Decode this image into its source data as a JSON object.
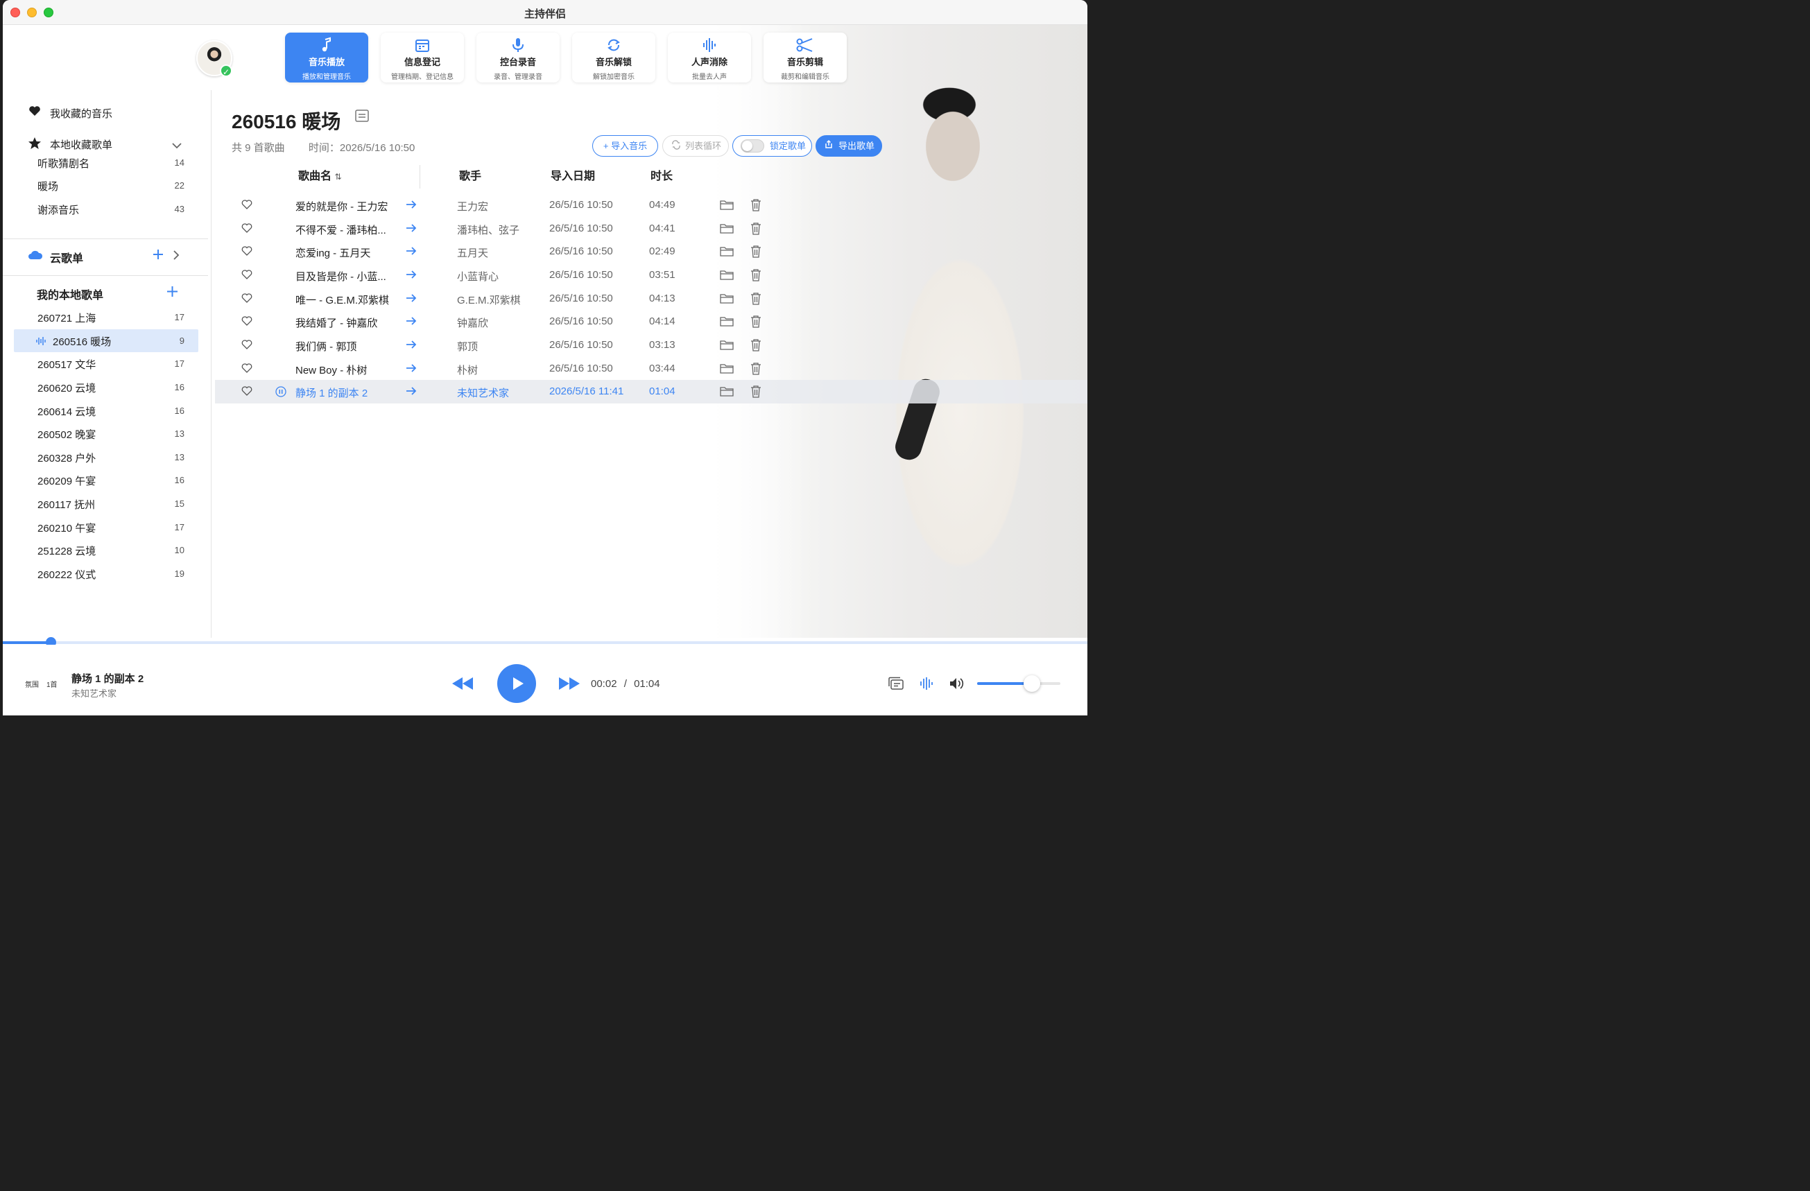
{
  "window": {
    "title": "主持伴侣"
  },
  "colors": {
    "accent": "#3d85f2",
    "selected_bg": "#dde9fb",
    "playing_row_bg": "#e8eaee"
  },
  "toolbar": {
    "tools": [
      {
        "label": "音乐播放",
        "sub": "播放和管理音乐",
        "icon": "music-note-icon",
        "active": true
      },
      {
        "label": "信息登记",
        "sub": "管理档期、登记信息",
        "icon": "calendar-icon",
        "active": false
      },
      {
        "label": "控台录音",
        "sub": "录音、管理录音",
        "icon": "microphone-icon",
        "active": false
      },
      {
        "label": "音乐解锁",
        "sub": "解锁加密音乐",
        "icon": "refresh-unlock-icon",
        "active": false
      },
      {
        "label": "人声消除",
        "sub": "批量去人声",
        "icon": "waveform-icon",
        "active": false
      },
      {
        "label": "音乐剪辑",
        "sub": "裁剪和编辑音乐",
        "icon": "scissors-icon",
        "active": false
      }
    ]
  },
  "sidebar": {
    "favorites": "我收藏的音乐",
    "local_collected": {
      "title": "本地收藏歌单",
      "items": [
        {
          "name": "听歌猜剧名",
          "count": "14"
        },
        {
          "name": "暖场",
          "count": "22"
        },
        {
          "name": "谢添音乐",
          "count": "43"
        }
      ]
    },
    "cloud": {
      "title": "云歌单"
    },
    "my_local": {
      "title": "我的本地歌单",
      "items": [
        {
          "name": "260721 上海",
          "count": "17"
        },
        {
          "name": "260516 暖场",
          "count": "9",
          "selected": true
        },
        {
          "name": "260517 文华",
          "count": "17"
        },
        {
          "name": "260620 云境",
          "count": "16"
        },
        {
          "name": "260614 云境",
          "count": "16"
        },
        {
          "name": "260502 晚宴",
          "count": "13"
        },
        {
          "name": "260328 户外",
          "count": "13"
        },
        {
          "name": "260209 午宴",
          "count": "16"
        },
        {
          "name": "260117 抚州",
          "count": "15"
        },
        {
          "name": "260210 午宴",
          "count": "17"
        },
        {
          "name": "251228 云境",
          "count": "10"
        },
        {
          "name": "260222 仪式",
          "count": "19"
        }
      ]
    }
  },
  "playlist": {
    "title": "260516 暖场",
    "count_text": "共 9 首歌曲",
    "time_text": "时间：2026/5/16 10:50",
    "buttons": {
      "import": "+ 导入音乐",
      "loop": "列表循环",
      "lock": "锁定歌单",
      "export": "导出歌单"
    },
    "lock_enabled": false,
    "columns": {
      "name": "歌曲名",
      "artist": "歌手",
      "date": "导入日期",
      "duration": "时长"
    },
    "songs": [
      {
        "name": "爱的就是你 - 王力宏",
        "artist": "王力宏",
        "date": "26/5/16 10:50",
        "duration": "04:49"
      },
      {
        "name": "不得不爱 - 潘玮柏...",
        "artist": "潘玮柏、弦子",
        "date": "26/5/16 10:50",
        "duration": "04:41"
      },
      {
        "name": "恋爱ing - 五月天",
        "artist": "五月天",
        "date": "26/5/16 10:50",
        "duration": "02:49"
      },
      {
        "name": "目及皆是你 - 小蓝...",
        "artist": "小蓝背心",
        "date": "26/5/16 10:50",
        "duration": "03:51"
      },
      {
        "name": "唯一 - G.E.M.邓紫棋",
        "artist": "G.E.M.邓紫棋",
        "date": "26/5/16 10:50",
        "duration": "04:13"
      },
      {
        "name": "我结婚了 - 钟嘉欣",
        "artist": "钟嘉欣",
        "date": "26/5/16 10:50",
        "duration": "04:14"
      },
      {
        "name": "我们俩 - 郭顶",
        "artist": "郭顶",
        "date": "26/5/16 10:50",
        "duration": "03:13"
      },
      {
        "name": "New Boy - 朴树",
        "artist": "朴树",
        "date": "26/5/16 10:50",
        "duration": "03:44"
      },
      {
        "name": "静场 1 的副本 2",
        "artist": "未知艺术家",
        "date": "2026/5/16 11:41",
        "duration": "01:04",
        "playing": true
      }
    ]
  },
  "player": {
    "mini_icons": [
      "氛围",
      "1首"
    ],
    "now_title": "静场 1 的副本 2",
    "now_artist": "未知艺术家",
    "current_time": "00:02",
    "separator": "/",
    "total_time": "01:04",
    "progress": 0.044,
    "volume": 0.66
  }
}
